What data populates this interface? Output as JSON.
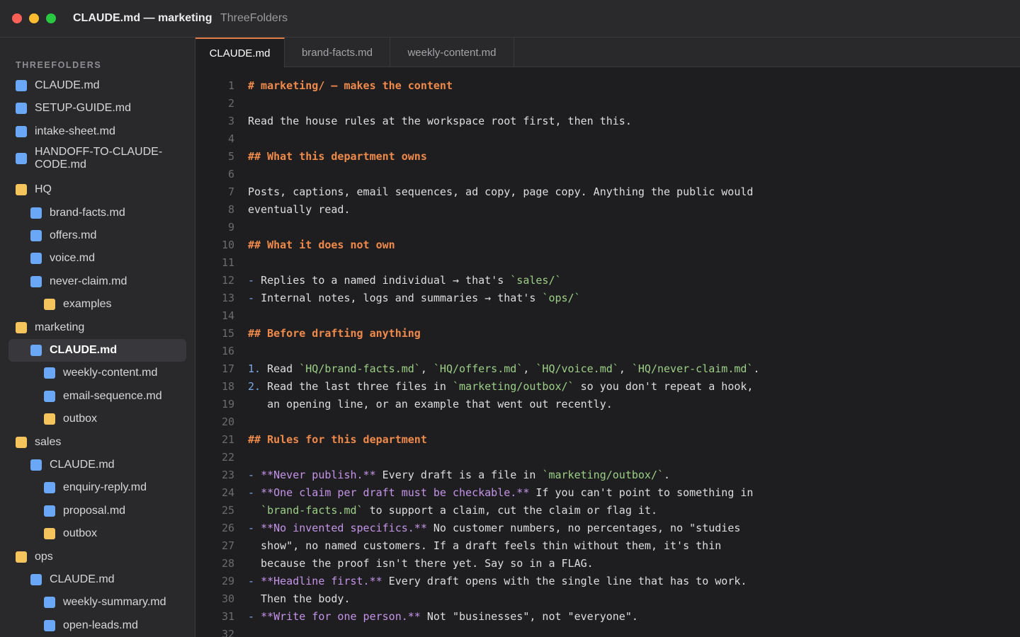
{
  "window": {
    "title": "CLAUDE.md — marketing",
    "subtitle": "ThreeFolders"
  },
  "sidebar": {
    "heading": "THREEFOLDERS",
    "items": [
      {
        "label": "CLAUDE.md",
        "kind": "file",
        "depth": 0
      },
      {
        "label": "SETUP-GUIDE.md",
        "kind": "file",
        "depth": 0
      },
      {
        "label": "intake-sheet.md",
        "kind": "file",
        "depth": 0
      },
      {
        "label": "HANDOFF-TO-CLAUDE-CODE.md",
        "kind": "file",
        "depth": 0,
        "lines": [
          "HANDOFF-TO-CLAUDE-",
          "CODE.md"
        ]
      },
      {
        "label": "HQ",
        "kind": "folder",
        "depth": 0
      },
      {
        "label": "brand-facts.md",
        "kind": "file",
        "depth": 1
      },
      {
        "label": "offers.md",
        "kind": "file",
        "depth": 1
      },
      {
        "label": "voice.md",
        "kind": "file",
        "depth": 1
      },
      {
        "label": "never-claim.md",
        "kind": "file",
        "depth": 1
      },
      {
        "label": "examples",
        "kind": "folder",
        "depth": 2
      },
      {
        "label": "marketing",
        "kind": "folder",
        "depth": 0
      },
      {
        "label": "CLAUDE.md",
        "kind": "file",
        "depth": 1,
        "active": true
      },
      {
        "label": "weekly-content.md",
        "kind": "file",
        "depth": 2
      },
      {
        "label": "email-sequence.md",
        "kind": "file",
        "depth": 2
      },
      {
        "label": "outbox",
        "kind": "folder",
        "depth": 2
      },
      {
        "label": "sales",
        "kind": "folder",
        "depth": 0
      },
      {
        "label": "CLAUDE.md",
        "kind": "file",
        "depth": 1
      },
      {
        "label": "enquiry-reply.md",
        "kind": "file",
        "depth": 2
      },
      {
        "label": "proposal.md",
        "kind": "file",
        "depth": 2
      },
      {
        "label": "outbox",
        "kind": "folder",
        "depth": 2
      },
      {
        "label": "ops",
        "kind": "folder",
        "depth": 0
      },
      {
        "label": "CLAUDE.md",
        "kind": "file",
        "depth": 1
      },
      {
        "label": "weekly-summary.md",
        "kind": "file",
        "depth": 2
      },
      {
        "label": "open-leads.md",
        "kind": "file",
        "depth": 2
      }
    ]
  },
  "tabs": [
    {
      "label": "CLAUDE.md",
      "active": true
    },
    {
      "label": "brand-facts.md",
      "active": false
    },
    {
      "label": "weekly-content.md",
      "active": false
    }
  ],
  "icons": {
    "file": "file-icon",
    "folder": "folder-icon"
  },
  "colors": {
    "accent": "#e07a45",
    "heading": "#f08a4b",
    "bold": "#c594e8",
    "code": "#9ccf86",
    "list_marker": "#7fa9e6",
    "file_icon": "#6aa8f7",
    "folder_icon": "#f6c45c"
  },
  "editor": {
    "lines": [
      {
        "n": "1",
        "tokens": [
          [
            "h",
            "# marketing/ — makes the content"
          ]
        ]
      },
      {
        "n": "2",
        "tokens": []
      },
      {
        "n": "3",
        "tokens": [
          [
            "t",
            "Read the house rules at the workspace root first, then this."
          ]
        ]
      },
      {
        "n": "4",
        "tokens": []
      },
      {
        "n": "5",
        "tokens": [
          [
            "h",
            "## What this department owns"
          ]
        ]
      },
      {
        "n": "6",
        "tokens": []
      },
      {
        "n": "7",
        "tokens": [
          [
            "t",
            "Posts, captions, email sequences, ad copy, page copy. Anything the public would"
          ]
        ]
      },
      {
        "n": "8",
        "tokens": [
          [
            "t",
            "eventually read."
          ]
        ]
      },
      {
        "n": "9",
        "tokens": []
      },
      {
        "n": "10",
        "tokens": [
          [
            "h",
            "## What it does not own"
          ]
        ]
      },
      {
        "n": "11",
        "tokens": []
      },
      {
        "n": "12",
        "tokens": [
          [
            "m",
            "- "
          ],
          [
            "t",
            "Replies to a named individual → that's "
          ],
          [
            "c",
            "`sales/`"
          ]
        ]
      },
      {
        "n": "13",
        "tokens": [
          [
            "m",
            "- "
          ],
          [
            "t",
            "Internal notes, logs and summaries → that's "
          ],
          [
            "c",
            "`ops/`"
          ]
        ]
      },
      {
        "n": "14",
        "tokens": []
      },
      {
        "n": "15",
        "tokens": [
          [
            "h",
            "## Before drafting anything"
          ]
        ]
      },
      {
        "n": "16",
        "tokens": []
      },
      {
        "n": "17",
        "tokens": [
          [
            "m",
            "1. "
          ],
          [
            "t",
            "Read "
          ],
          [
            "c",
            "`HQ/brand-facts.md`"
          ],
          [
            "t",
            ", "
          ],
          [
            "c",
            "`HQ/offers.md`"
          ],
          [
            "t",
            ", "
          ],
          [
            "c",
            "`HQ/voice.md`"
          ],
          [
            "t",
            ", "
          ],
          [
            "c",
            "`HQ/never-claim.md`"
          ],
          [
            "t",
            "."
          ]
        ]
      },
      {
        "n": "18",
        "tokens": [
          [
            "m",
            "2. "
          ],
          [
            "t",
            "Read the last three files in "
          ],
          [
            "c",
            "`marketing/outbox/`"
          ],
          [
            "t",
            " so you don't repeat a hook,"
          ]
        ]
      },
      {
        "n": "19",
        "tokens": [
          [
            "t",
            "   an opening line, or an example that went out recently."
          ]
        ]
      },
      {
        "n": "20",
        "tokens": []
      },
      {
        "n": "21",
        "tokens": [
          [
            "h",
            "## Rules for this department"
          ]
        ]
      },
      {
        "n": "22",
        "tokens": []
      },
      {
        "n": "23",
        "tokens": [
          [
            "m",
            "- "
          ],
          [
            "b",
            "**Never publish.**"
          ],
          [
            "t",
            " Every draft is a file in "
          ],
          [
            "c",
            "`marketing/outbox/`"
          ],
          [
            "t",
            "."
          ]
        ]
      },
      {
        "n": "24",
        "tokens": [
          [
            "m",
            "- "
          ],
          [
            "b",
            "**One claim per draft must be checkable.**"
          ],
          [
            "t",
            " If you can't point to something in"
          ]
        ]
      },
      {
        "n": "25",
        "tokens": [
          [
            "t",
            "  "
          ],
          [
            "c",
            "`brand-facts.md`"
          ],
          [
            "t",
            " to support a claim, cut the claim or flag it."
          ]
        ]
      },
      {
        "n": "26",
        "tokens": [
          [
            "m",
            "- "
          ],
          [
            "b",
            "**No invented specifics.**"
          ],
          [
            "t",
            " No customer numbers, no percentages, no \"studies"
          ]
        ]
      },
      {
        "n": "27",
        "tokens": [
          [
            "t",
            "  show\", no named customers. If a draft feels thin without them, it's thin"
          ]
        ]
      },
      {
        "n": "28",
        "tokens": [
          [
            "t",
            "  because the proof isn't there yet. Say so in a FLAG."
          ]
        ]
      },
      {
        "n": "29",
        "tokens": [
          [
            "m",
            "- "
          ],
          [
            "b",
            "**Headline first.**"
          ],
          [
            "t",
            " Every draft opens with the single line that has to work."
          ]
        ]
      },
      {
        "n": "30",
        "tokens": [
          [
            "t",
            "  Then the body."
          ]
        ]
      },
      {
        "n": "31",
        "tokens": [
          [
            "m",
            "- "
          ],
          [
            "b",
            "**Write for one person.**"
          ],
          [
            "t",
            " Not \"businesses\", not \"everyone\"."
          ]
        ]
      },
      {
        "n": "32",
        "tokens": []
      }
    ]
  }
}
